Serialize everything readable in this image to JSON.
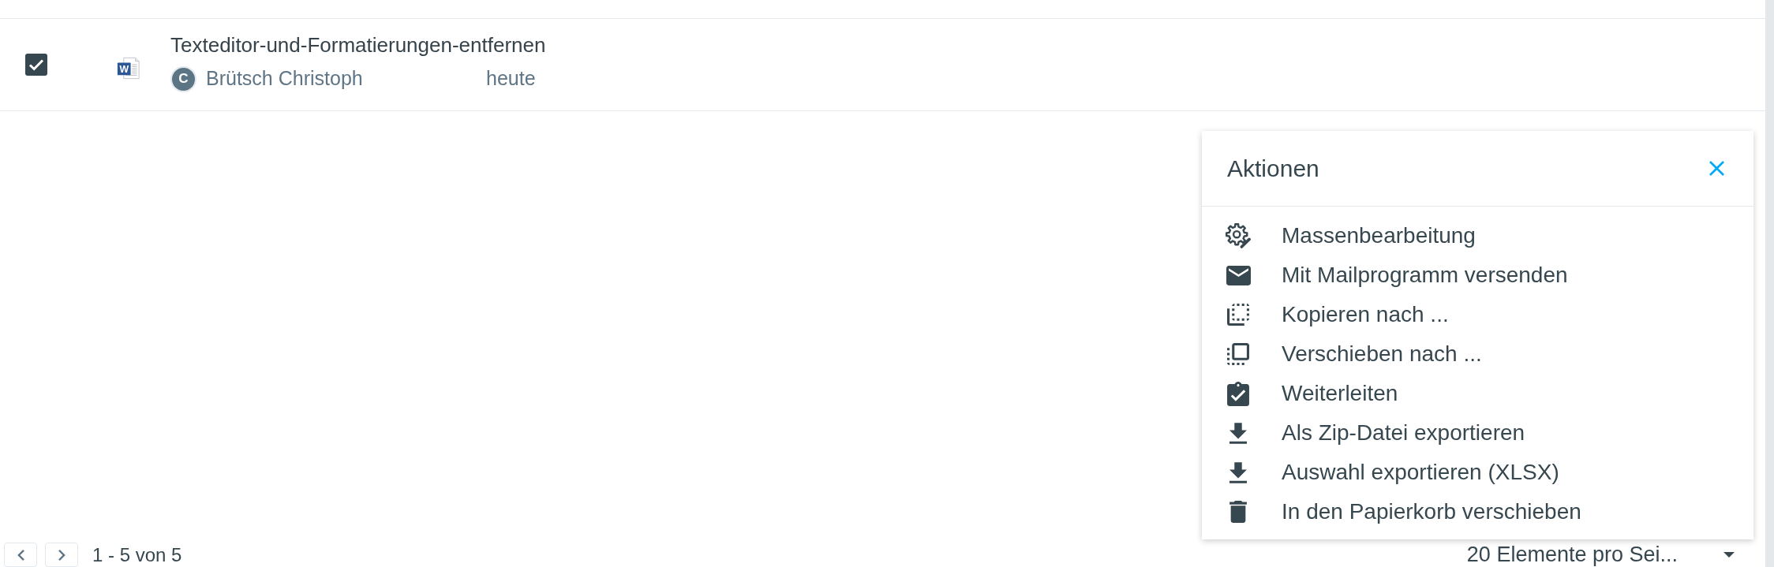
{
  "file_list": {
    "rows": [
      {
        "checked": true,
        "name": "Texteditor-und-Formatierungen-entfernen",
        "icon_letter": "W",
        "person": {
          "initial": "C",
          "name": "Brütsch Christoph"
        },
        "date": "heute"
      }
    ]
  },
  "actions_panel": {
    "title": "Aktionen",
    "items": [
      {
        "kind": "edit",
        "label": "Massenbearbeitung"
      },
      {
        "kind": "mail",
        "label": "Mit Mailprogramm versenden"
      },
      {
        "kind": "copy",
        "label": "Kopieren nach ..."
      },
      {
        "kind": "move",
        "label": "Verschieben nach ..."
      },
      {
        "kind": "forward",
        "label": "Weiterleiten"
      },
      {
        "kind": "export",
        "label": "Als Zip-Datei exportieren"
      },
      {
        "kind": "export",
        "label": "Auswahl exportieren (XLSX)"
      },
      {
        "kind": "trash",
        "label": "In den Papierkorb verschieben"
      }
    ]
  },
  "pagination": {
    "range": "1 - 5 von 5",
    "page_size": "20 Elemente pro Sei..."
  }
}
